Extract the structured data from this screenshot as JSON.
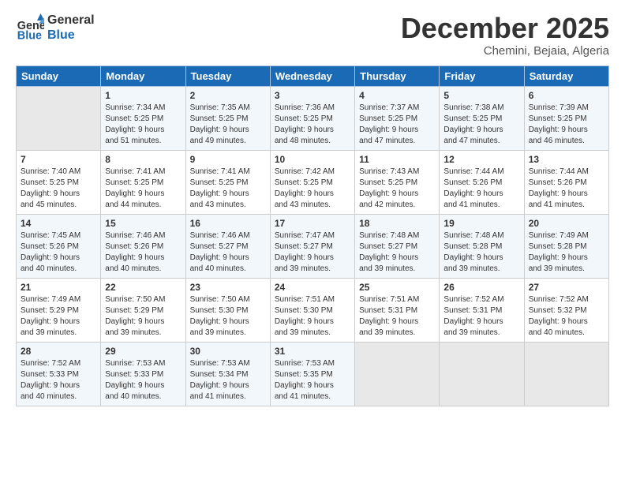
{
  "header": {
    "logo_line1": "General",
    "logo_line2": "Blue",
    "month": "December 2025",
    "location": "Chemini, Bejaia, Algeria"
  },
  "weekdays": [
    "Sunday",
    "Monday",
    "Tuesday",
    "Wednesday",
    "Thursday",
    "Friday",
    "Saturday"
  ],
  "weeks": [
    [
      {
        "day": "",
        "content": ""
      },
      {
        "day": "1",
        "content": "Sunrise: 7:34 AM\nSunset: 5:25 PM\nDaylight: 9 hours\nand 51 minutes."
      },
      {
        "day": "2",
        "content": "Sunrise: 7:35 AM\nSunset: 5:25 PM\nDaylight: 9 hours\nand 49 minutes."
      },
      {
        "day": "3",
        "content": "Sunrise: 7:36 AM\nSunset: 5:25 PM\nDaylight: 9 hours\nand 48 minutes."
      },
      {
        "day": "4",
        "content": "Sunrise: 7:37 AM\nSunset: 5:25 PM\nDaylight: 9 hours\nand 47 minutes."
      },
      {
        "day": "5",
        "content": "Sunrise: 7:38 AM\nSunset: 5:25 PM\nDaylight: 9 hours\nand 47 minutes."
      },
      {
        "day": "6",
        "content": "Sunrise: 7:39 AM\nSunset: 5:25 PM\nDaylight: 9 hours\nand 46 minutes."
      }
    ],
    [
      {
        "day": "7",
        "content": "Sunrise: 7:40 AM\nSunset: 5:25 PM\nDaylight: 9 hours\nand 45 minutes."
      },
      {
        "day": "8",
        "content": "Sunrise: 7:41 AM\nSunset: 5:25 PM\nDaylight: 9 hours\nand 44 minutes."
      },
      {
        "day": "9",
        "content": "Sunrise: 7:41 AM\nSunset: 5:25 PM\nDaylight: 9 hours\nand 43 minutes."
      },
      {
        "day": "10",
        "content": "Sunrise: 7:42 AM\nSunset: 5:25 PM\nDaylight: 9 hours\nand 43 minutes."
      },
      {
        "day": "11",
        "content": "Sunrise: 7:43 AM\nSunset: 5:25 PM\nDaylight: 9 hours\nand 42 minutes."
      },
      {
        "day": "12",
        "content": "Sunrise: 7:44 AM\nSunset: 5:26 PM\nDaylight: 9 hours\nand 41 minutes."
      },
      {
        "day": "13",
        "content": "Sunrise: 7:44 AM\nSunset: 5:26 PM\nDaylight: 9 hours\nand 41 minutes."
      }
    ],
    [
      {
        "day": "14",
        "content": "Sunrise: 7:45 AM\nSunset: 5:26 PM\nDaylight: 9 hours\nand 40 minutes."
      },
      {
        "day": "15",
        "content": "Sunrise: 7:46 AM\nSunset: 5:26 PM\nDaylight: 9 hours\nand 40 minutes."
      },
      {
        "day": "16",
        "content": "Sunrise: 7:46 AM\nSunset: 5:27 PM\nDaylight: 9 hours\nand 40 minutes."
      },
      {
        "day": "17",
        "content": "Sunrise: 7:47 AM\nSunset: 5:27 PM\nDaylight: 9 hours\nand 39 minutes."
      },
      {
        "day": "18",
        "content": "Sunrise: 7:48 AM\nSunset: 5:27 PM\nDaylight: 9 hours\nand 39 minutes."
      },
      {
        "day": "19",
        "content": "Sunrise: 7:48 AM\nSunset: 5:28 PM\nDaylight: 9 hours\nand 39 minutes."
      },
      {
        "day": "20",
        "content": "Sunrise: 7:49 AM\nSunset: 5:28 PM\nDaylight: 9 hours\nand 39 minutes."
      }
    ],
    [
      {
        "day": "21",
        "content": "Sunrise: 7:49 AM\nSunset: 5:29 PM\nDaylight: 9 hours\nand 39 minutes."
      },
      {
        "day": "22",
        "content": "Sunrise: 7:50 AM\nSunset: 5:29 PM\nDaylight: 9 hours\nand 39 minutes."
      },
      {
        "day": "23",
        "content": "Sunrise: 7:50 AM\nSunset: 5:30 PM\nDaylight: 9 hours\nand 39 minutes."
      },
      {
        "day": "24",
        "content": "Sunrise: 7:51 AM\nSunset: 5:30 PM\nDaylight: 9 hours\nand 39 minutes."
      },
      {
        "day": "25",
        "content": "Sunrise: 7:51 AM\nSunset: 5:31 PM\nDaylight: 9 hours\nand 39 minutes."
      },
      {
        "day": "26",
        "content": "Sunrise: 7:52 AM\nSunset: 5:31 PM\nDaylight: 9 hours\nand 39 minutes."
      },
      {
        "day": "27",
        "content": "Sunrise: 7:52 AM\nSunset: 5:32 PM\nDaylight: 9 hours\nand 40 minutes."
      }
    ],
    [
      {
        "day": "28",
        "content": "Sunrise: 7:52 AM\nSunset: 5:33 PM\nDaylight: 9 hours\nand 40 minutes."
      },
      {
        "day": "29",
        "content": "Sunrise: 7:53 AM\nSunset: 5:33 PM\nDaylight: 9 hours\nand 40 minutes."
      },
      {
        "day": "30",
        "content": "Sunrise: 7:53 AM\nSunset: 5:34 PM\nDaylight: 9 hours\nand 41 minutes."
      },
      {
        "day": "31",
        "content": "Sunrise: 7:53 AM\nSunset: 5:35 PM\nDaylight: 9 hours\nand 41 minutes."
      },
      {
        "day": "",
        "content": ""
      },
      {
        "day": "",
        "content": ""
      },
      {
        "day": "",
        "content": ""
      }
    ]
  ]
}
